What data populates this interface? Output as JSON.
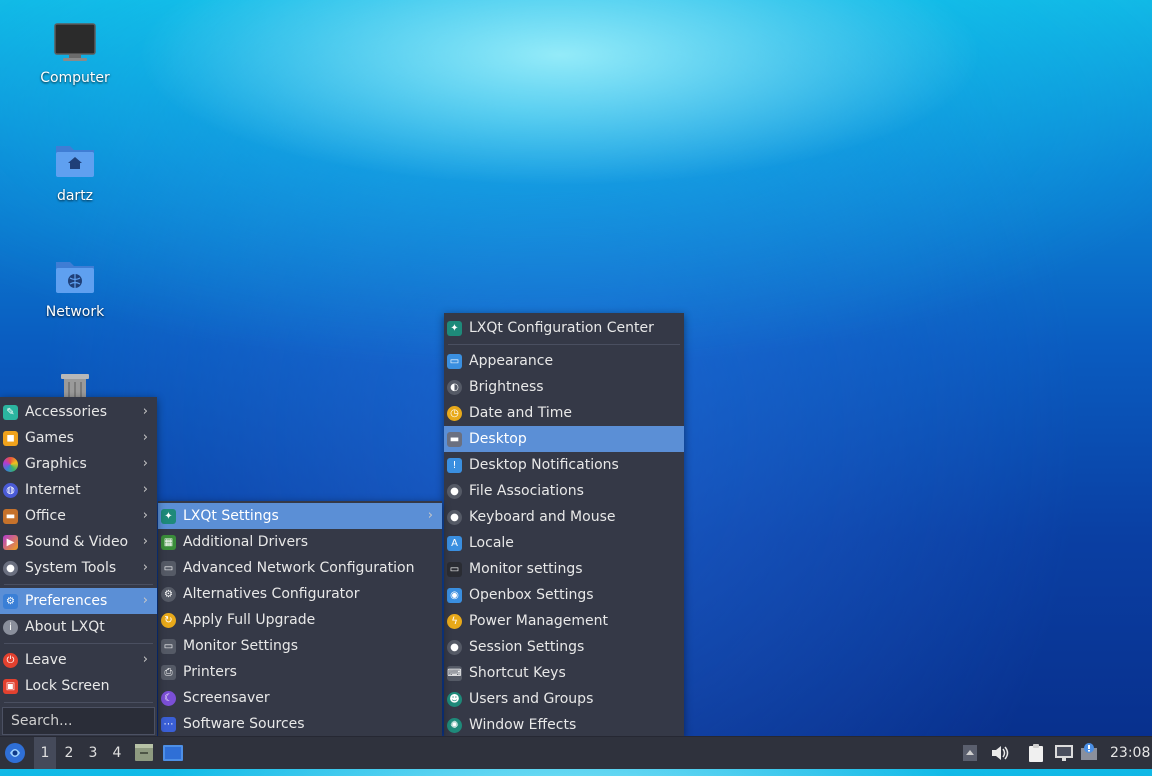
{
  "desktop": {
    "icons": [
      {
        "label": "Computer",
        "icon": "monitor-icon"
      },
      {
        "label": "dartz",
        "icon": "home-folder-icon"
      },
      {
        "label": "Network",
        "icon": "network-folder-icon"
      },
      {
        "label": "",
        "icon": "trash-icon"
      }
    ]
  },
  "main_menu": {
    "items": [
      {
        "label": "Accessories",
        "icon": "accessories-icon",
        "color": "#2bb5a0"
      },
      {
        "label": "Games",
        "icon": "gamepad-icon",
        "color": "#f0a21c"
      },
      {
        "label": "Graphics",
        "icon": "graphics-icon",
        "color": "#e8523f"
      },
      {
        "label": "Internet",
        "icon": "globe-icon",
        "color": "#4a5bd6"
      },
      {
        "label": "Office",
        "icon": "briefcase-icon",
        "color": "#c6722b"
      },
      {
        "label": "Sound & Video",
        "icon": "multimedia-icon",
        "color": "#b33bd1"
      },
      {
        "label": "System Tools",
        "icon": "system-tools-icon",
        "color": "#6b7080"
      },
      {
        "label": "Preferences",
        "icon": "preferences-icon",
        "color": "#3a7fd6"
      },
      {
        "label": "About LXQt",
        "icon": "info-icon",
        "color": "#8a8f9c"
      },
      {
        "label": "Leave",
        "icon": "power-icon",
        "color": "#e2412f"
      },
      {
        "label": "Lock Screen",
        "icon": "lock-icon",
        "color": "#e2412f"
      }
    ],
    "search_placeholder": "Search..."
  },
  "preferences_menu": {
    "items": [
      {
        "label": "LXQt Settings",
        "icon": "lxqt-icon",
        "color": "#1e8a7a"
      },
      {
        "label": "Additional Drivers",
        "icon": "chip-icon",
        "color": "#3a8d3a"
      },
      {
        "label": "Advanced Network Configuration",
        "icon": "network-config-icon",
        "color": "#555a66"
      },
      {
        "label": "Alternatives Configurator",
        "icon": "alternatives-icon",
        "color": "#555a66"
      },
      {
        "label": "Apply Full Upgrade",
        "icon": "upgrade-icon",
        "color": "#e8a91a"
      },
      {
        "label": "Monitor Settings",
        "icon": "monitor-settings-icon",
        "color": "#555a66"
      },
      {
        "label": "Printers",
        "icon": "printer-icon",
        "color": "#555a66"
      },
      {
        "label": "Screensaver",
        "icon": "screensaver-icon",
        "color": "#7b4fd6"
      },
      {
        "label": "Software Sources",
        "icon": "software-sources-icon",
        "color": "#3a5fd6"
      }
    ]
  },
  "lxqt_settings_menu": {
    "items": [
      {
        "label": "LXQt Configuration Center",
        "icon": "lxqt-icon",
        "color": "#1e8a7a"
      },
      {
        "label": "Appearance",
        "icon": "appearance-icon",
        "color": "#3a8fe0"
      },
      {
        "label": "Brightness",
        "icon": "brightness-icon",
        "color": "#555a66"
      },
      {
        "label": "Date and Time",
        "icon": "clock-icon",
        "color": "#e8a91a"
      },
      {
        "label": "Desktop",
        "icon": "desktop-icon",
        "color": "#6b7080"
      },
      {
        "label": "Desktop Notifications",
        "icon": "notification-icon",
        "color": "#3a8fe0"
      },
      {
        "label": "File Associations",
        "icon": "file-associations-icon",
        "color": "#555a66"
      },
      {
        "label": "Keyboard and Mouse",
        "icon": "mouse-icon",
        "color": "#555a66"
      },
      {
        "label": "Locale",
        "icon": "locale-icon",
        "color": "#3a8fe0"
      },
      {
        "label": "Monitor settings",
        "icon": "monitor-icon",
        "color": "#555a66"
      },
      {
        "label": "Openbox Settings",
        "icon": "openbox-icon",
        "color": "#3a8fe0"
      },
      {
        "label": "Power Management",
        "icon": "power-management-icon",
        "color": "#e8a91a"
      },
      {
        "label": "Session Settings",
        "icon": "session-icon",
        "color": "#555a66"
      },
      {
        "label": "Shortcut Keys",
        "icon": "keyboard-icon",
        "color": "#555a66"
      },
      {
        "label": "Users and Groups",
        "icon": "users-icon",
        "color": "#1e8a7a"
      },
      {
        "label": "Window Effects",
        "icon": "window-effects-icon",
        "color": "#1e8a7a"
      }
    ]
  },
  "taskbar": {
    "workspaces": [
      "1",
      "2",
      "3",
      "4"
    ],
    "clock": "23:08"
  },
  "colors": {
    "menu_bg": "#353947",
    "highlight": "#5b8fd6",
    "taskbar_bg": "#2f323d"
  }
}
